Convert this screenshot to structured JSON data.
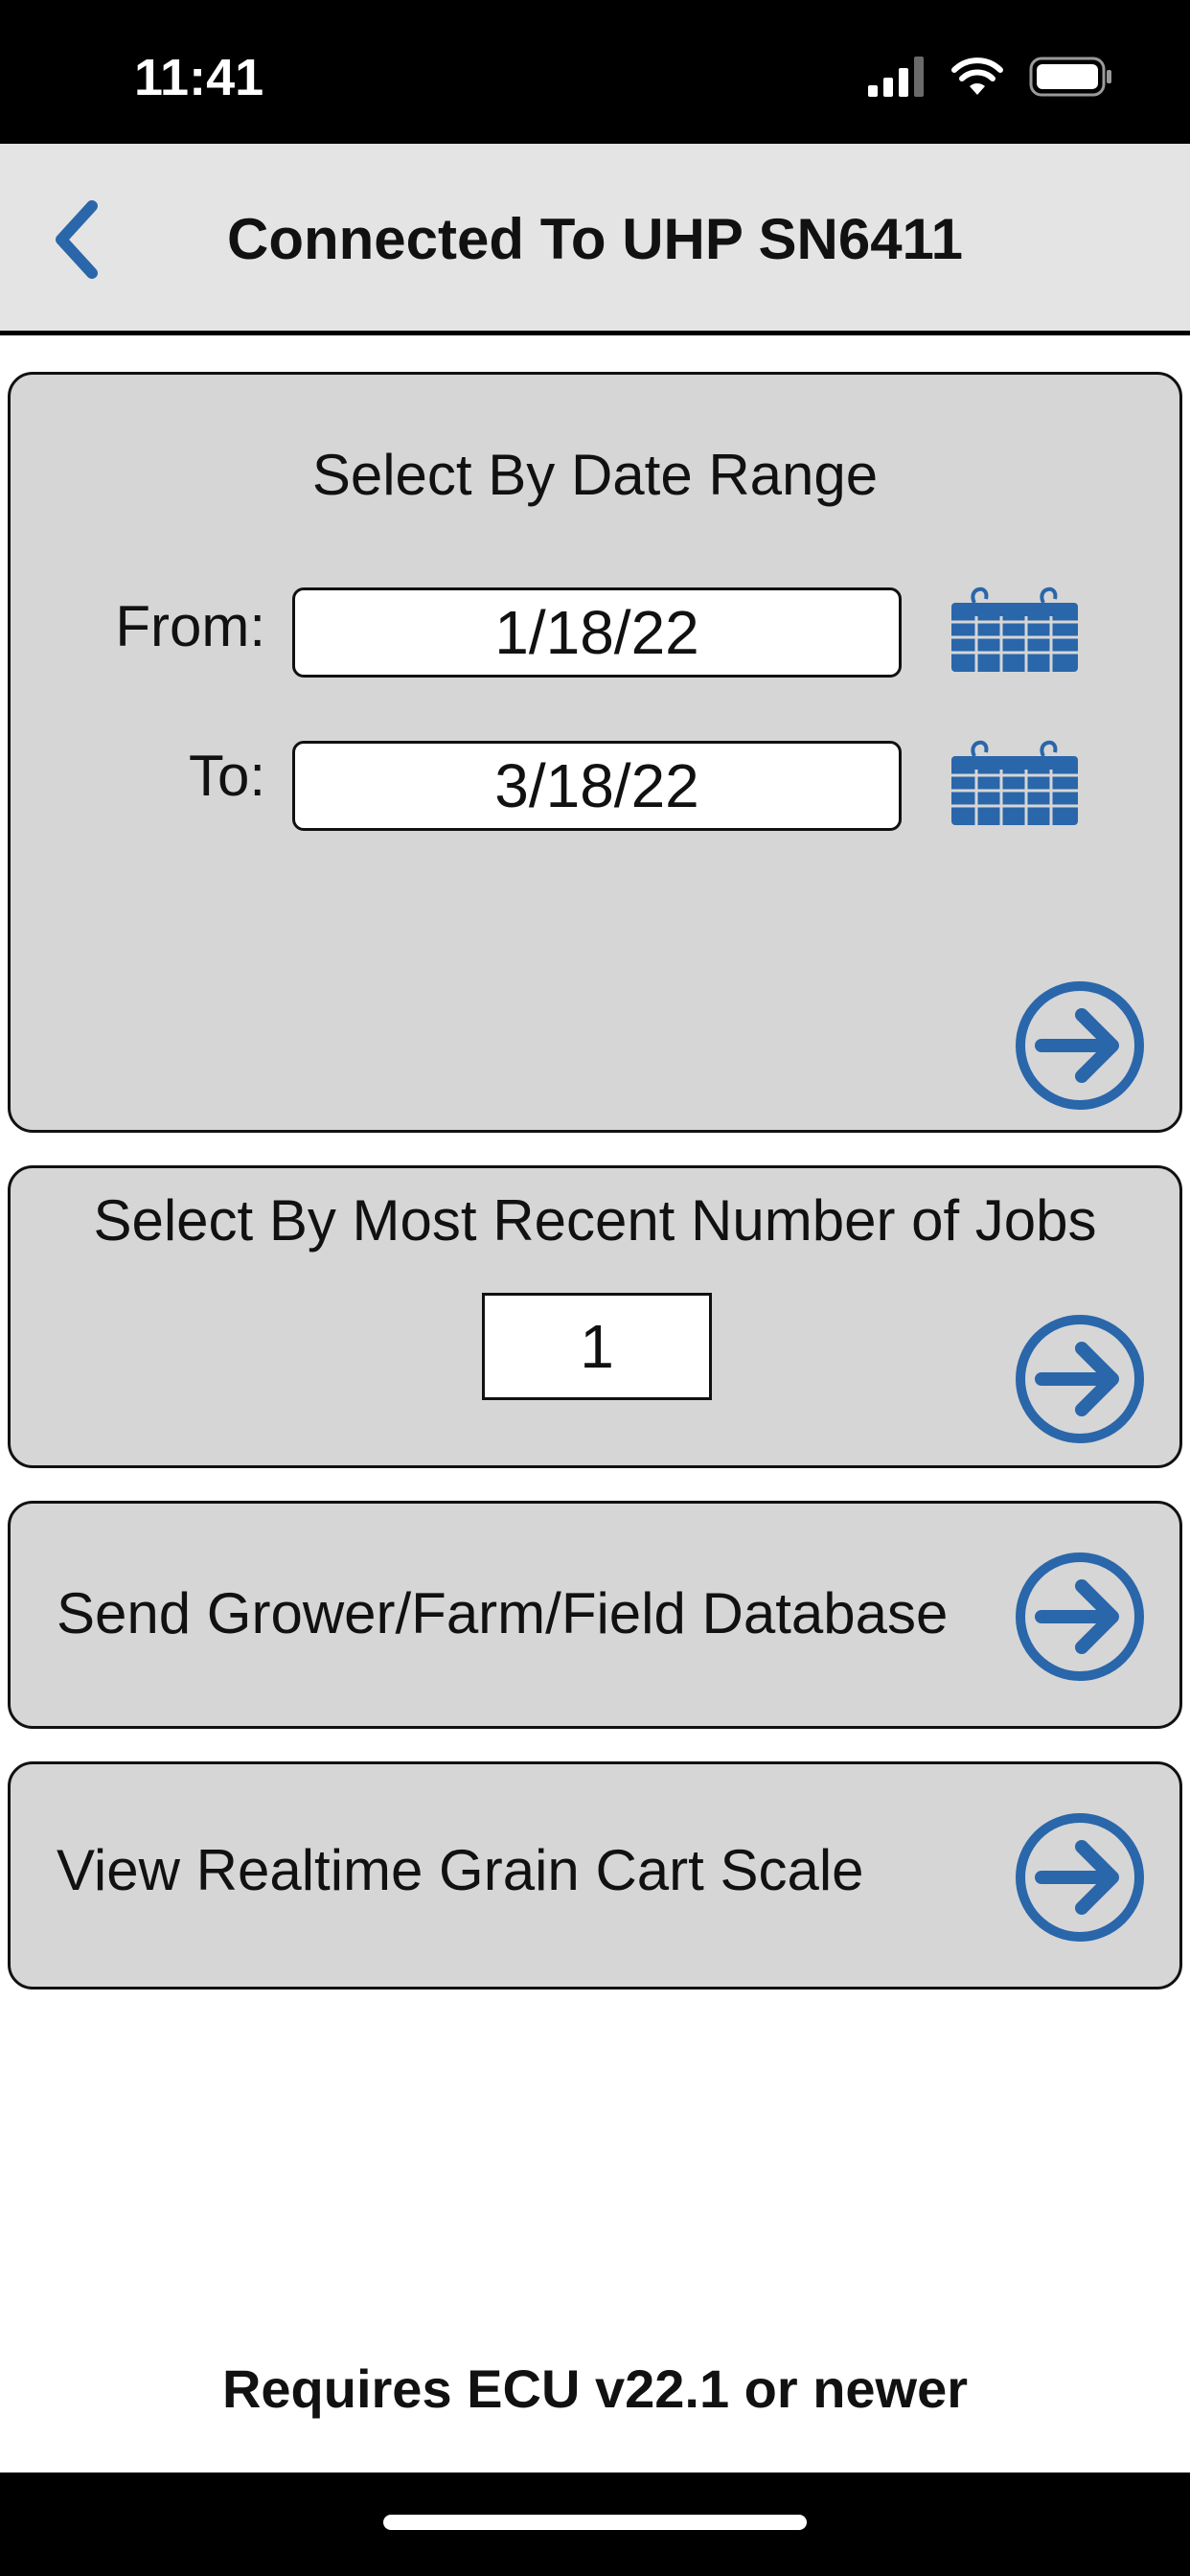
{
  "status_bar": {
    "time": "11:41"
  },
  "nav": {
    "title": "Connected To UHP SN6411",
    "back_icon": "chevron-left-icon"
  },
  "date_range": {
    "title": "Select By Date Range",
    "from_label": "From:",
    "from_value": "1/18/22",
    "to_label": "To:",
    "to_value": "3/18/22"
  },
  "recent_jobs": {
    "title": "Select By Most Recent Number of Jobs",
    "value": "1"
  },
  "send_database": {
    "label": "Send Grower/Farm/Field Database"
  },
  "realtime_scale": {
    "label": "View Realtime Grain Cart Scale"
  },
  "footer": {
    "note": "Requires ECU v22.1 or newer"
  },
  "colors": {
    "accent": "#2a66aa",
    "card_bg": "#d6d6d6",
    "nav_bg": "#e4e4e4"
  }
}
